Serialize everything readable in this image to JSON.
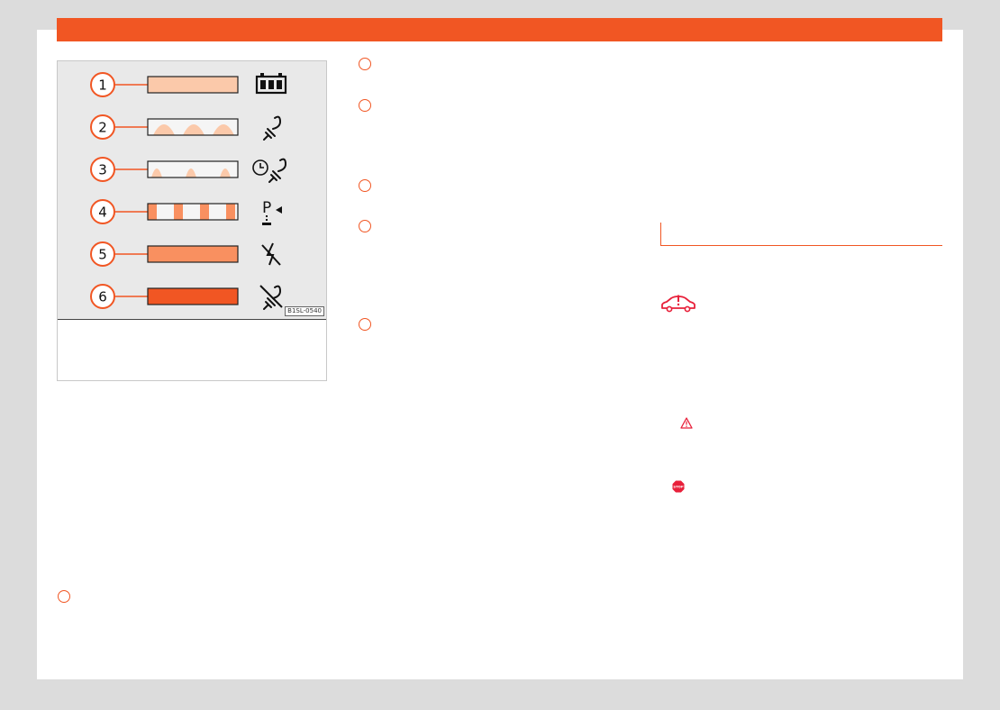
{
  "figure": {
    "code": "B1SL-0540",
    "rows": [
      {
        "number": "1",
        "pattern": "solid-light",
        "icon": "battery-icon"
      },
      {
        "number": "2",
        "pattern": "wave-large",
        "icon": "charging-plug-icon"
      },
      {
        "number": "3",
        "pattern": "wave-small",
        "icon": "timer-charging-icon"
      },
      {
        "number": "4",
        "pattern": "blocks",
        "icon": "parking-indicator-icon"
      },
      {
        "number": "5",
        "pattern": "solid-medium",
        "icon": "no-power-icon"
      },
      {
        "number": "6",
        "pattern": "solid-dark",
        "icon": "charging-fault-icon"
      }
    ]
  },
  "colors": {
    "accent": "#f15623",
    "light": "#fbc9aa",
    "medium": "#f99060",
    "dark": "#f15623",
    "warning_red": "#e8203a"
  },
  "icons": {
    "car_warning": "car-warning-icon",
    "warning_triangle": "warning-triangle-icon",
    "stop": "stop-icon"
  }
}
